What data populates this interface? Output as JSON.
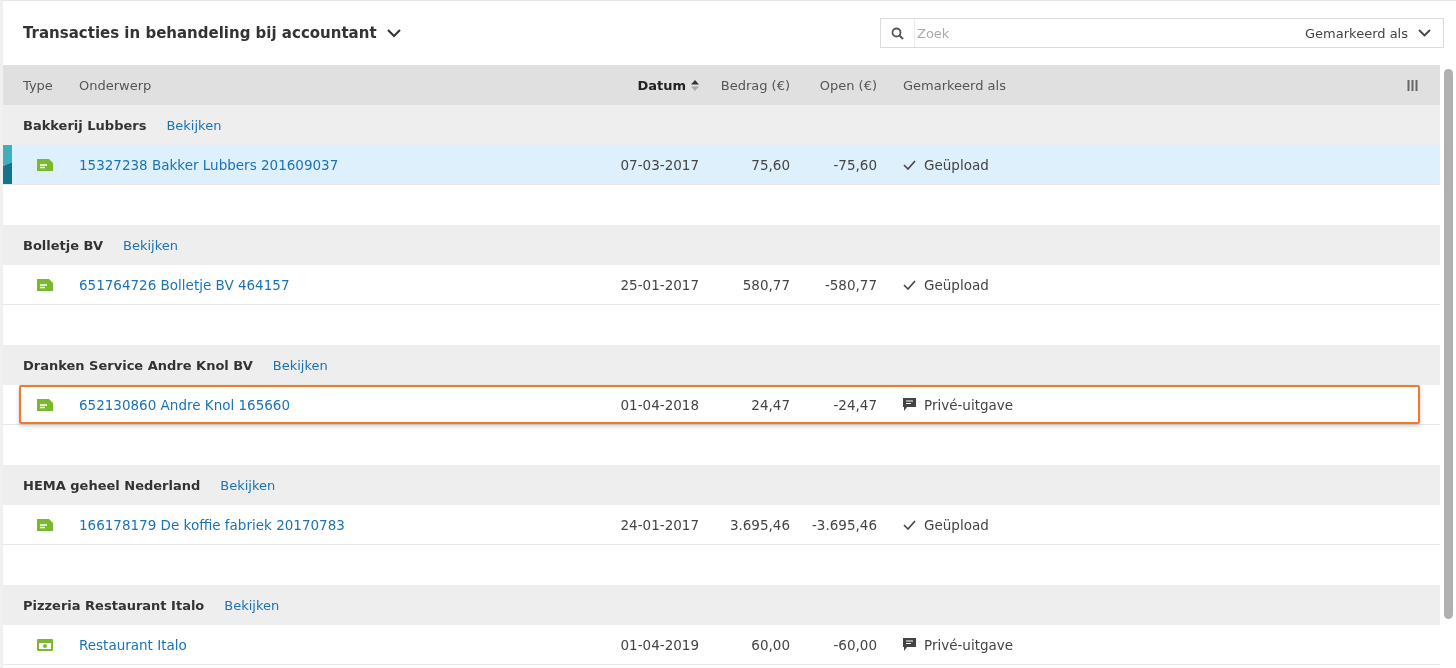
{
  "header": {
    "title": "Transacties in behandeling bij accountant",
    "search": {
      "placeholder": "Zoek"
    },
    "filter": "Gemarkeerd als"
  },
  "table": {
    "columns": [
      {
        "label": "Type",
        "sorted": false
      },
      {
        "label": "Onderwerp",
        "sorted": false
      },
      {
        "label": "Datum",
        "sorted": true
      },
      {
        "label": "Bedrag (€)",
        "sorted": false
      },
      {
        "label": "Open (€)",
        "sorted": false
      },
      {
        "label": "Gemarkeerd als",
        "sorted": false
      }
    ],
    "groups": [
      {
        "name": "Bakkerij Lubbers",
        "link": "Bekijken",
        "rows": [
          {
            "kind": "invoice",
            "subject": "15327238 Bakker Lubbers 201609037",
            "date": "07-03-2017",
            "amount": "75,60",
            "open": "-75,60",
            "mark": {
              "kind": "check",
              "label": "Geüpload"
            },
            "selected": true,
            "highlighted": false
          }
        ]
      },
      {
        "name": "Bolletje BV",
        "link": "Bekijken",
        "rows": [
          {
            "kind": "invoice",
            "subject": "651764726 Bolletje BV 464157",
            "date": "25-01-2017",
            "amount": "580,77",
            "open": "-580,77",
            "mark": {
              "kind": "check",
              "label": "Geüpload"
            },
            "selected": false,
            "highlighted": false
          }
        ]
      },
      {
        "name": "Dranken Service Andre Knol BV",
        "link": "Bekijken",
        "rows": [
          {
            "kind": "invoice",
            "subject": "652130860 Andre Knol 165660",
            "date": "01-04-2018",
            "amount": "24,47",
            "open": "-24,47",
            "mark": {
              "kind": "comment",
              "label": "Privé-uitgave"
            },
            "selected": false,
            "highlighted": true
          }
        ]
      },
      {
        "name": "HEMA geheel Nederland",
        "link": "Bekijken",
        "rows": [
          {
            "kind": "invoice",
            "subject": "166178179 De koffie fabriek 20170783",
            "date": "24-01-2017",
            "amount": "3.695,46",
            "open": "-3.695,46",
            "mark": {
              "kind": "check",
              "label": "Geüpload"
            },
            "selected": false,
            "highlighted": false
          }
        ]
      },
      {
        "name": "Pizzeria Restaurant Italo",
        "link": "Bekijken",
        "rows": [
          {
            "kind": "cash",
            "subject": "Restaurant Italo",
            "date": "01-04-2019",
            "amount": "60,00",
            "open": "-60,00",
            "mark": {
              "kind": "comment",
              "label": "Privé-uitgave"
            },
            "selected": false,
            "highlighted": false
          }
        ]
      }
    ]
  }
}
